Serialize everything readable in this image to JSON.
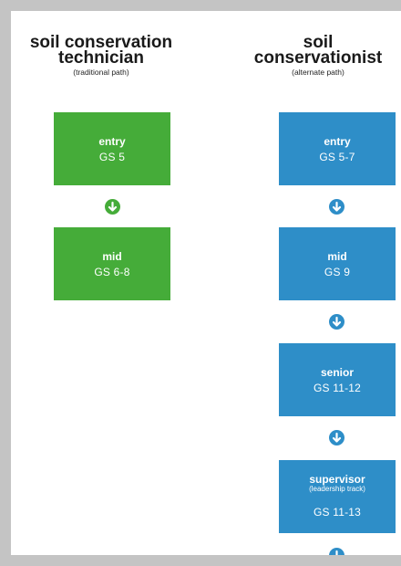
{
  "left_column": {
    "title_line1": "soil conservation",
    "title_line2": "technician",
    "subtitle": "(traditional path)",
    "steps": [
      {
        "level": "entry",
        "grade": "GS 5"
      },
      {
        "level": "mid",
        "grade": "GS 6-8"
      }
    ]
  },
  "right_column": {
    "title_line1": "soil",
    "title_line2": "conservationist",
    "subtitle": "(alternate path)",
    "steps": [
      {
        "level": "entry",
        "grade": "GS 5-7"
      },
      {
        "level": "mid",
        "grade": "GS 9"
      },
      {
        "level": "senior",
        "grade": "GS 11-12"
      },
      {
        "level": "supervisor",
        "note": "(leadership track)",
        "grade": "GS 11-13"
      }
    ]
  },
  "colors": {
    "green": "#45ac39",
    "blue": "#2e8ec8",
    "background": "#c4c4c4"
  },
  "icons": {
    "step_arrow": "arrow-down-circle-icon"
  }
}
